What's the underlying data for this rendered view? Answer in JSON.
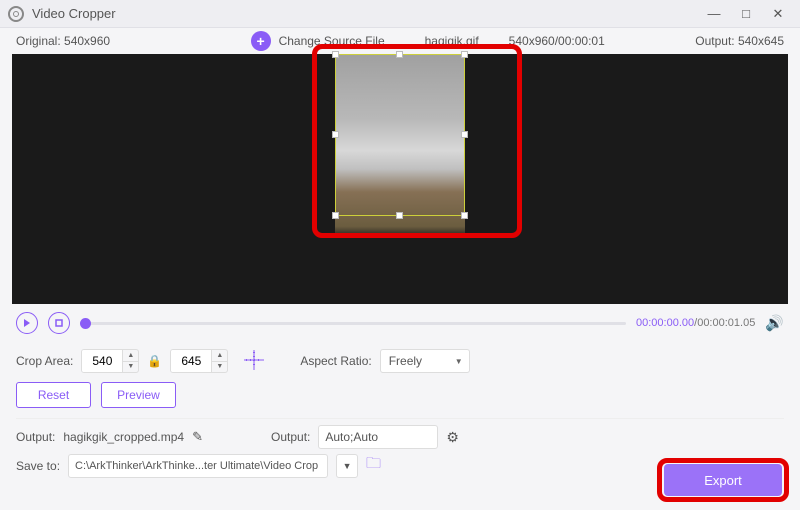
{
  "titlebar": {
    "title": "Video Cropper"
  },
  "infobar": {
    "original_label": "Original:",
    "original_value": "540x960",
    "change_label": "Change Source File",
    "filename": "haqiqik.gif",
    "source_wh_time": "540x960/00:00:01",
    "output_label": "Output:",
    "output_value": "540x645"
  },
  "playbar": {
    "current_time": "00:00:00.00",
    "total_time": "/00:00:01.05"
  },
  "crop": {
    "area_label": "Crop Area:",
    "w": "540",
    "h": "645",
    "aspect_label": "Aspect Ratio:",
    "aspect_value": "Freely",
    "reset": "Reset",
    "preview": "Preview"
  },
  "output": {
    "file_label": "Output:",
    "file_value": "hagikgik_cropped.mp4",
    "fmt_label": "Output:",
    "fmt_value": "Auto;Auto"
  },
  "save": {
    "label": "Save to:",
    "path": "C:\\ArkThinker\\ArkThinke...ter Ultimate\\Video Crop"
  },
  "export": {
    "label": "Export"
  }
}
